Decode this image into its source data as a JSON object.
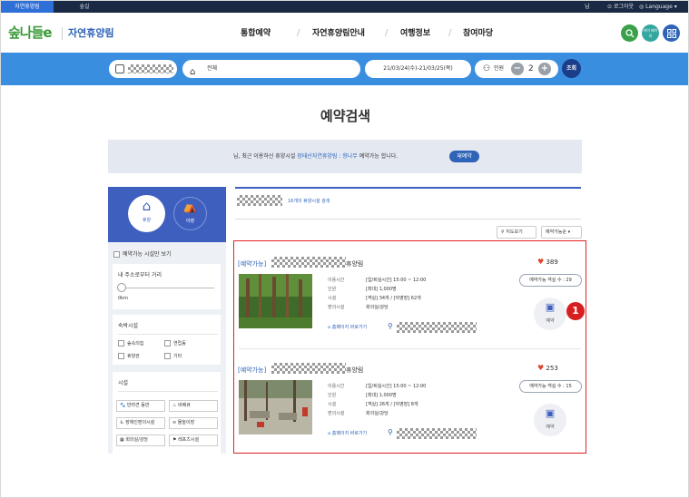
{
  "topbar": {
    "tab_active": "자연휴양림",
    "tab_second": "숲길",
    "user": "님",
    "logout": "로그아웃",
    "language": "Language"
  },
  "header": {
    "logo_text": "숲나들e",
    "site_title": "자연휴양림",
    "nav": [
      "통합예약",
      "자연휴양림안내",
      "여행정보",
      "참여마당"
    ],
    "mypage": "마이 페이지"
  },
  "searchbar": {
    "region": "전체",
    "dates": "21/03/24(수)-21/03/25(목)",
    "people_label": "인원",
    "people_count": "2",
    "search_button": "조회"
  },
  "page_title": "예약검색",
  "notice": {
    "prefix": "님, 최근 이용하신 휴양시설 ",
    "facility": "장태산자연휴양림 : 향나무",
    "suffix": " 예약가능 합니다.",
    "button": "재예약"
  },
  "filters": {
    "type_tabs": [
      "휴양",
      "야영"
    ],
    "available_only": "예약가능 시설만 보기",
    "distance_title": "내 주소로부터 거리",
    "distance_value": "0km",
    "lodging_title": "숙박시설",
    "lodging_options": [
      "숲속의집",
      "연립동",
      "휴양관",
      "기타"
    ],
    "facility_title": "시설",
    "facility_options": [
      "반려견 동반",
      "바베큐",
      "장애인편의시설",
      "물놀이장",
      "회의실/강당",
      "레포츠시설"
    ]
  },
  "results": {
    "count_text": "16개의 휴양시설 검색",
    "map_button": "지도보기",
    "sort_label": "예약가능순",
    "items": [
      {
        "status": "[예약가능]",
        "name_suffix": "휴양림",
        "likes": "389",
        "availability": "예약가능 객실 수 : 29",
        "reserve": "예약",
        "homepage": "홈페이지 바로가기",
        "rows": [
          {
            "label": "이용시간",
            "value": "[입/퇴실시간] 15:00 ~ 12:00"
          },
          {
            "label": "인원",
            "value": "[최대] 1,000명"
          },
          {
            "label": "시설",
            "value": "[객실] 34개 / [야영장] 62개"
          },
          {
            "label": "편의시설",
            "value": "회의실/강당"
          }
        ]
      },
      {
        "status": "[예약가능]",
        "name_suffix": "휴양림",
        "likes": "253",
        "availability": "예약가능 객실 수 : 15",
        "reserve": "예약",
        "homepage": "홈페이지 바로가기",
        "rows": [
          {
            "label": "이용시간",
            "value": "[입/퇴실시간] 15:00 ~ 12:00"
          },
          {
            "label": "인원",
            "value": "[최대] 1,000명"
          },
          {
            "label": "시설",
            "value": "[객실] 26개 / [야영장] 8개"
          },
          {
            "label": "편의시설",
            "value": "회의실/강당"
          }
        ]
      }
    ]
  },
  "annotation": "1",
  "colors": {
    "brand_blue": "#3a8ee0",
    "panel_blue": "#3f5fbf",
    "link_blue": "#2e63b8",
    "highlight_red": "#e02020"
  }
}
